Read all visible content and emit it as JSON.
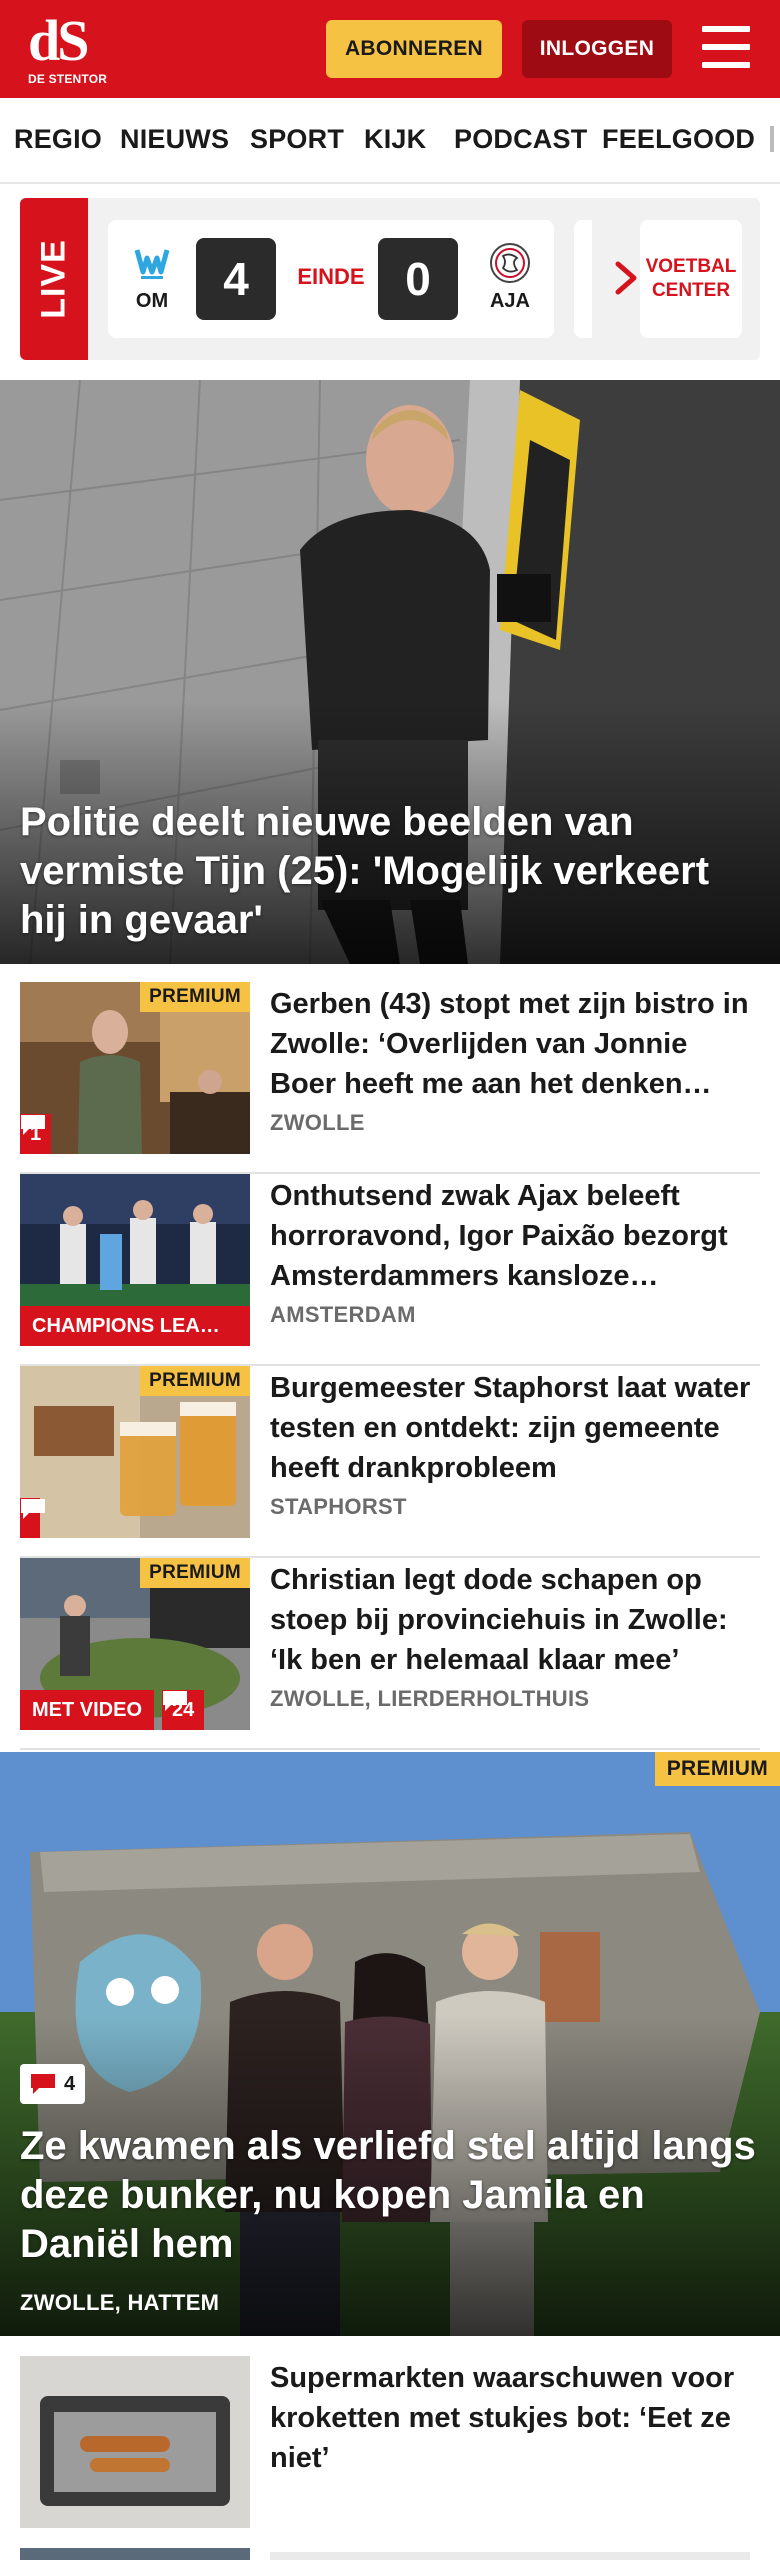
{
  "header": {
    "logo_mark": "dS",
    "logo_sub": "DE STENTOR",
    "subscribe_label": "ABONNEREN",
    "login_label": "INLOGGEN",
    "menu_icon": "hamburger-menu-icon",
    "colors": {
      "brand": "#d6131c",
      "subscribe": "#f6c243",
      "login": "#9e0b12"
    }
  },
  "nav": {
    "items": [
      "REGIO",
      "NIEUWS",
      "SPORT",
      "KIJK",
      "PODCAST",
      "FEELGOOD"
    ]
  },
  "live": {
    "label": "LIVE",
    "match": {
      "home": "OM",
      "away": "AJA",
      "home_score": "4",
      "away_score": "0",
      "status": "EINDE"
    },
    "next_icon": "chevron-right-icon",
    "center_label": "VOETBAL CENTER"
  },
  "hero": {
    "title": "Politie deelt nieuwe beelden van vermiste Tijn (25): 'Mogelijk verkeert hij in gevaar'"
  },
  "articles": [
    {
      "title": "Gerben (43) stopt met zijn bistro in Zwolle: ‘Overlijden van Jonnie Boer heeft me aan het denken…",
      "location": "ZWOLLE",
      "premium": "PREMIUM",
      "comments": "1"
    },
    {
      "title": "Onthutsend zwak Ajax beleeft horroravond, Igor Paixão bezorgt Amsterdammers kansloze…",
      "location": "AMSTERDAM",
      "tag": "CHAMPIONS LEA…"
    },
    {
      "title": "Burgemeester Staphorst laat water testen en ontdekt: zijn gemeente heeft drankprobleem",
      "location": "STAPHORST",
      "premium": "PREMIUM"
    },
    {
      "title": "Christian legt dode schapen op stoep bij provinciehuis in Zwolle: ‘Ik ben er helemaal klaar mee’",
      "location": "ZWOLLE, LIERDERHOLTHUIS",
      "premium": "PREMIUM",
      "video_label": "MET VIDEO",
      "comments": "24"
    }
  ],
  "feature": {
    "premium": "PREMIUM",
    "comments": "4",
    "title": "Ze kwamen als verliefd stel altijd langs deze bunker, nu kopen Jamila en Daniël hem",
    "location": "ZWOLLE, HATTEM"
  },
  "bottom_article": {
    "title": "Supermarkten waarschuwen voor kroketten met stukjes bot: ‘Eet ze niet’"
  }
}
